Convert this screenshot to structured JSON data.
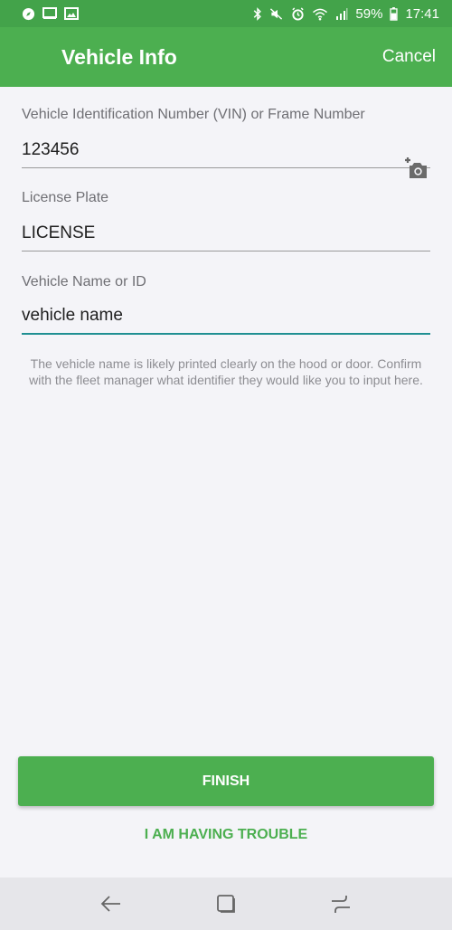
{
  "status_bar": {
    "battery_percent": "59%",
    "time": "17:41",
    "left_icons": [
      "compass-icon",
      "screen-icon",
      "image-icon"
    ],
    "right_icons": [
      "bluetooth-icon",
      "mute-icon",
      "alarm-icon",
      "wifi-icon",
      "signal-icon",
      "battery-icon"
    ]
  },
  "app_bar": {
    "title": "Vehicle Info",
    "cancel_label": "Cancel"
  },
  "form": {
    "vin": {
      "label": "Vehicle Identification Number (VIN) or Frame Number",
      "value": "123456"
    },
    "license": {
      "label": "License Plate",
      "value": "LICENSE"
    },
    "vehicle_name": {
      "label": "Vehicle Name or ID",
      "value": "vehicle name"
    },
    "hint": "The vehicle name is likely printed clearly on the hood or door. Confirm with the fleet manager what identifier they would like you to input here."
  },
  "actions": {
    "finish_label": "FINISH",
    "trouble_label": "I AM HAVING TROUBLE"
  },
  "colors": {
    "primary": "#4caf50",
    "status_bar": "#43a34a",
    "focus_underline": "#1f8f92",
    "background": "#f4f4f8"
  },
  "nav_bar": {
    "icons": [
      "back-icon",
      "home-icon",
      "recents-icon"
    ]
  }
}
